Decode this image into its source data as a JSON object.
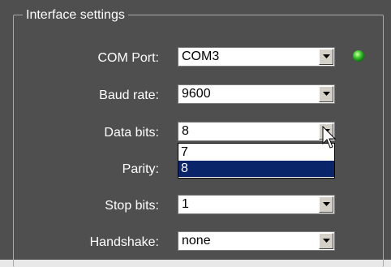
{
  "group": {
    "title": "Interface settings"
  },
  "fields": [
    {
      "label": "COM Port:",
      "value": "COM3"
    },
    {
      "label": "Baud rate:",
      "value": "9600"
    },
    {
      "label": "Data bits:",
      "value": "8"
    },
    {
      "label": "Parity:",
      "value": ""
    },
    {
      "label": "Stop bits:",
      "value": "1"
    },
    {
      "label": "Handshake:",
      "value": "none"
    }
  ],
  "data_bits_dropdown": {
    "options": [
      "7",
      "8"
    ],
    "selected": "8"
  },
  "status_led": {
    "color": "#3fcf2f",
    "icon": "green-led-icon"
  }
}
